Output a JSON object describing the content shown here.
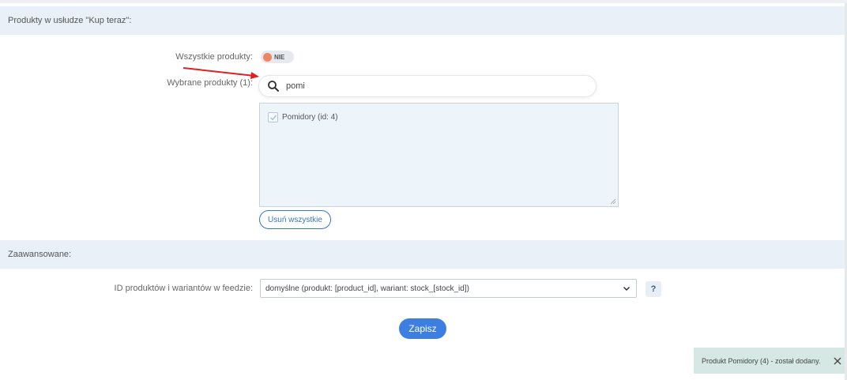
{
  "section_products": {
    "title": "Produkty w usłudze \"Kup teraz\":"
  },
  "all_products": {
    "label": "Wszystkie produkty:",
    "toggle_text": "NIE",
    "toggle_color": "#ee8566"
  },
  "selected_products": {
    "label": "Wybrane produkty (1):",
    "search_value": "pomi",
    "items": [
      {
        "label": "Pomidory (id: 4)",
        "checked": true
      }
    ],
    "remove_all_label": "Usuń wszystkie"
  },
  "section_advanced": {
    "title": "Zaawansowane:"
  },
  "feed_ids": {
    "label": "ID produktów i wariantów w feedzie:",
    "selected_value": "domyślne (produkt: [product_id], wariant: stock_[stock_id])",
    "help_label": "?"
  },
  "save_button": {
    "label": "Zapisz",
    "color": "#3d7fe0"
  },
  "toast": {
    "message": "Produkt Pomidory (4) - został dodany.",
    "background": "#d6e8e3"
  },
  "annotation": {
    "arrow_color": "#e02020"
  }
}
